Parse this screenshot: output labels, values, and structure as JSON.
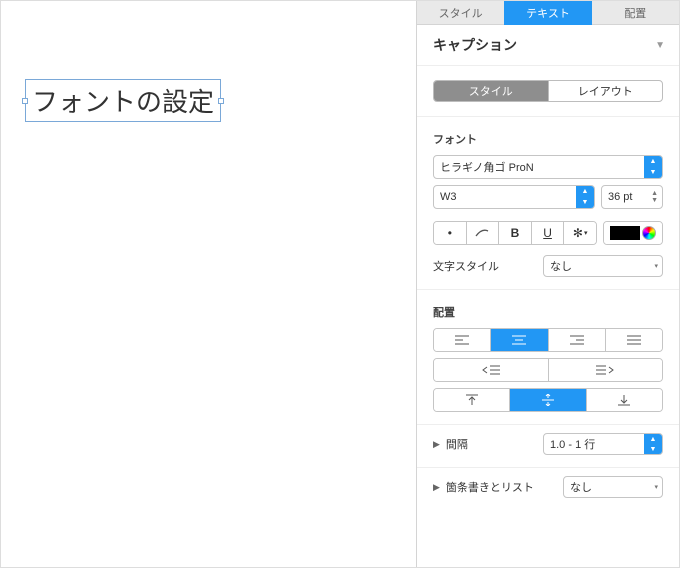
{
  "canvas": {
    "text": "フォントの設定"
  },
  "tabs": {
    "style": "スタイル",
    "text": "テキスト",
    "arrange": "配置"
  },
  "header": "キャプション",
  "pills": {
    "style": "スタイル",
    "layout": "レイアウト"
  },
  "font": {
    "label": "フォント",
    "family": "ヒラギノ角ゴ ProN",
    "weight": "W3",
    "size": "36 pt",
    "charstyle_label": "文字スタイル",
    "charstyle_value": "なし"
  },
  "align": {
    "label": "配置"
  },
  "spacing": {
    "label": "間隔",
    "value": "1.0 - 1 行"
  },
  "bullets": {
    "label": "箇条書きとリスト",
    "value": "なし"
  }
}
